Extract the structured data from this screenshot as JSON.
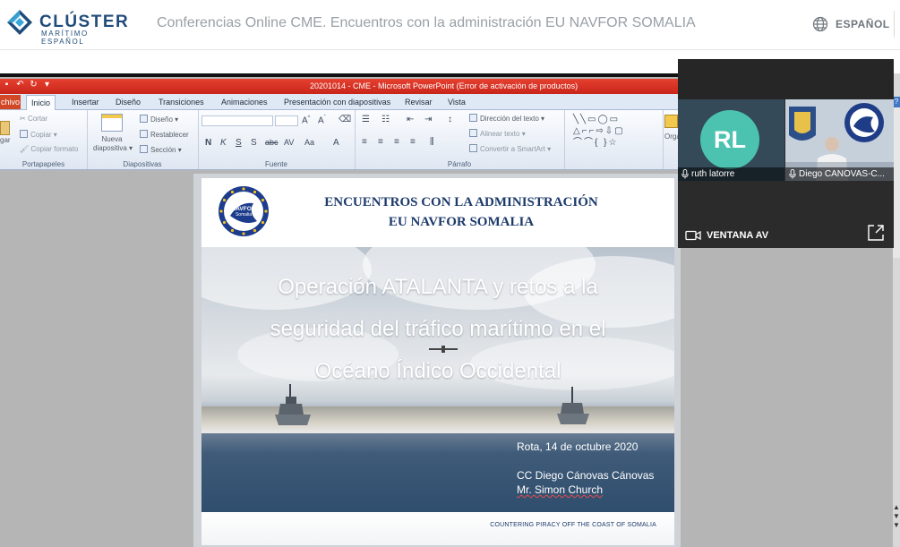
{
  "header": {
    "logo_name": "CLÚSTER",
    "logo_sub": "MARÍTIMO ESPAÑOL",
    "conference_title": "Conferencias Online CME. Encuentros con la administración EU NAVFOR SOMALIA",
    "language_label": "ESPAÑOL"
  },
  "powerpoint": {
    "window_title": "20201014 - CME - Microsoft PowerPoint (Error de activación de productos)",
    "tabs": [
      "chivo",
      "Inicio",
      "Insertar",
      "Diseño",
      "Transiciones",
      "Animaciones",
      "Presentación con diapositivas",
      "Revisar",
      "Vista"
    ],
    "ribbon": {
      "portapapeles": {
        "paste": "gar",
        "cut": "Cortar",
        "copy": "Copiar",
        "format_painter": "Copiar formato",
        "label": "Portapapeles"
      },
      "diapositivas": {
        "new_slide_1": "Nueva",
        "new_slide_2": "diapositiva",
        "layout": "Diseño",
        "reset": "Restablecer",
        "section": "Sección",
        "label": "Diapositivas"
      },
      "fuente": {
        "label": "Fuente",
        "bold": "N",
        "italic": "K",
        "underline": "S",
        "shadow": "S",
        "strike": "abc",
        "spacing": "AV",
        "case": "Aa",
        "color": "A"
      },
      "parrafo": {
        "text_direction": "Dirección del texto",
        "align_text": "Alinear texto",
        "smartart": "Convertir a SmartArt",
        "label": "Párrafo"
      },
      "organize": "Orga"
    }
  },
  "slide": {
    "heading_line1": "ENCUENTROS CON LA ADMINISTRACIÓN",
    "heading_line2": "EU NAVFOR SOMALIA",
    "logo_text_top": "EU",
    "logo_text_mid": "NAVFOR",
    "logo_text_bot": "Somalia",
    "title_line1": "Operación ATALANTA y retos a la",
    "title_line2": "seguridad del tráfico marítimo en el",
    "title_line3": "Océano Índico Occidental",
    "date": "Rota, 14 de octubre 2020",
    "speaker1": "CC Diego Cánovas Cánovas",
    "speaker2": "Mr. Simon Church",
    "footer": "COUNTERING PIRACY OFF THE COAST OF SOMALIA"
  },
  "video_panel": {
    "participants": [
      {
        "initials": "RL",
        "name": "ruth latorre",
        "avatar_color": "#4cc3b1"
      },
      {
        "name": "Diego CANOVAS-C..."
      }
    ],
    "ventana_label": "VENTANA AV"
  },
  "colors": {
    "brand_blue": "#1f4c7a",
    "pp_titlebar": "#d93a2b",
    "pp_file_tab": "#d24726",
    "slide_heading": "#1c3a6b"
  }
}
